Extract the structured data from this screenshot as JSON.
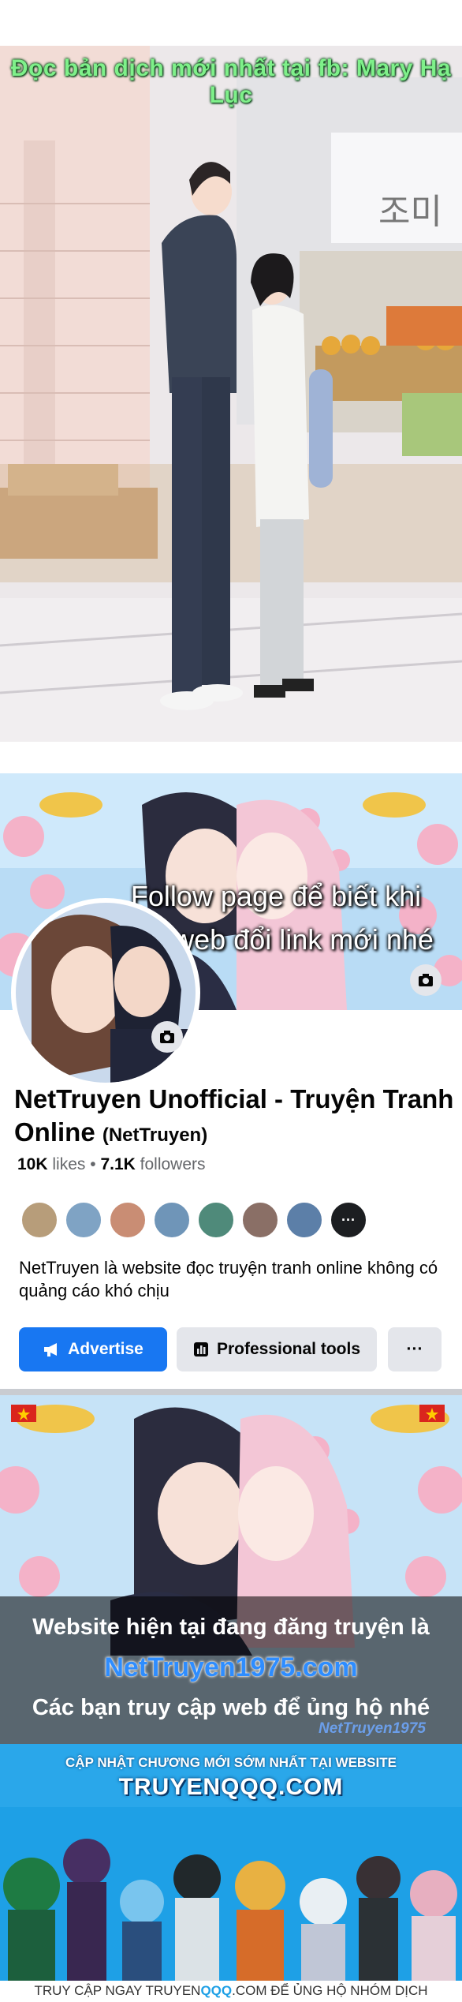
{
  "credit": "Đọc bản dịch mới nhất tại fb: Mary Hạ Lục",
  "scene": {
    "shop_sign": "조미"
  },
  "facebook": {
    "overlay_line1": "Follow page để biết khi",
    "overlay_line2": "nào web đổi link mới nhé",
    "page_name": "NetTruyen Unofficial - Truyện Tranh Online",
    "page_alias": "(NetTruyen)",
    "likes_count": "10K",
    "likes_label": "likes",
    "separator": "•",
    "followers_count": "7.1K",
    "followers_label": "followers",
    "bio": "NetTruyen là website đọc truyện tranh online không có quảng cáo khó chịu",
    "buttons": {
      "advertise": "Advertise",
      "professional_tools": "Professional tools",
      "more": "···"
    },
    "more_friends": "···"
  },
  "promo": {
    "line1": "Website hiện tại đang đăng truyện là",
    "site": "NetTruyen1975.com",
    "line3": "Các bạn truy cập web để ủng hộ nhé",
    "watermark": "NetTruyen1975"
  },
  "truyenqq": {
    "header": "CẬP NHẬT CHƯƠNG MỚI SỚM NHẤT TẠI WEBSITE",
    "logo": "TRUYENQQQ.COM",
    "footer_pre": "TRUY CẬP NGAY TRUYEN",
    "footer_mid": "QQQ",
    "footer_post": ".COM ĐỂ ỦNG HỘ NHÓM DỊCH"
  },
  "colors": {
    "fb_blue": "#1877f2",
    "credit_green": "#7ff08a",
    "qq_bg": "#1ea0e6",
    "promo_site": "#2e8dff"
  }
}
